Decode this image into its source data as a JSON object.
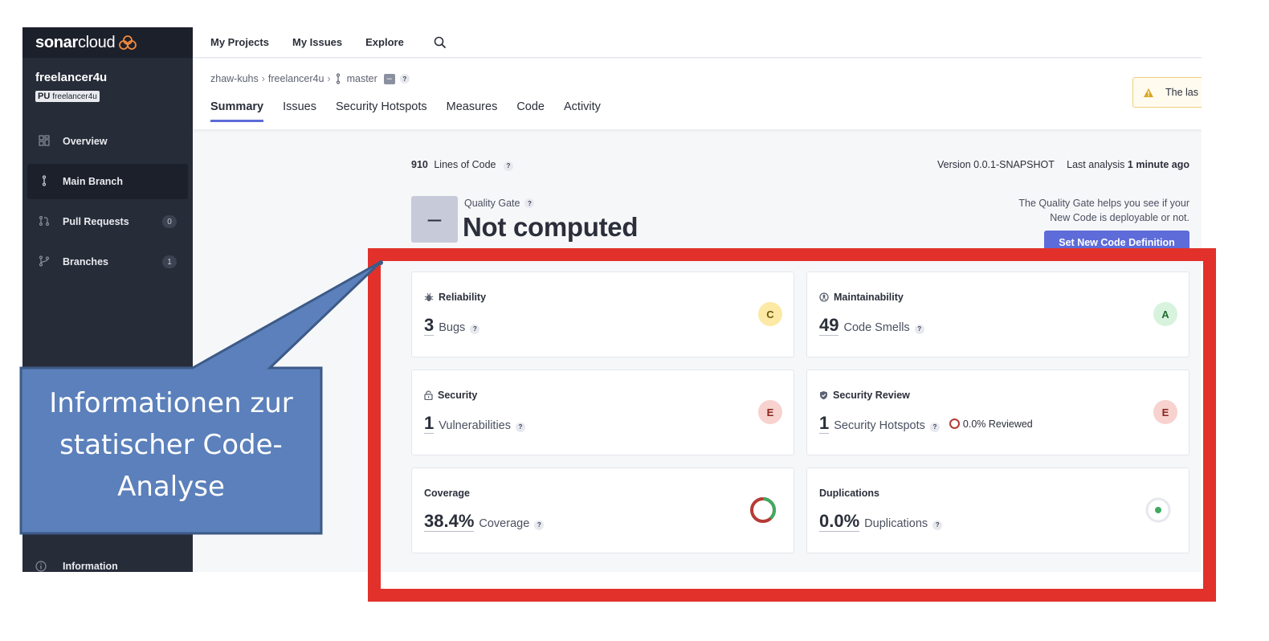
{
  "app": {
    "brand": {
      "bold": "sonar",
      "light": "cloud"
    },
    "topnav": {
      "my_projects": "My Projects",
      "my_issues": "My Issues",
      "explore": "Explore"
    }
  },
  "sidebar": {
    "project_name": "freelancer4u",
    "project_key_badge": "PU",
    "project_key": "freelancer4u",
    "items": [
      {
        "label": "Overview",
        "icon": "grid-icon"
      },
      {
        "label": "Main Branch",
        "icon": "branch-icon",
        "active": true
      },
      {
        "label": "Pull Requests",
        "icon": "pull-request-icon",
        "count": "0"
      },
      {
        "label": "Branches",
        "icon": "branches-icon",
        "count": "1"
      }
    ],
    "information": "Information"
  },
  "breadcrumb": {
    "org": "zhaw-kuhs",
    "project": "freelancer4u",
    "branch": "master",
    "badge": "–",
    "help": "?"
  },
  "tabs": [
    "Summary",
    "Issues",
    "Security Hotspots",
    "Measures",
    "Code",
    "Activity"
  ],
  "warning": {
    "text": "The las"
  },
  "overview": {
    "loc_value": "910",
    "loc_label": "Lines of Code",
    "version": "Version 0.0.1-SNAPSHOT",
    "last_analysis_label": "Last analysis",
    "last_analysis_value": "1 minute ago",
    "quality_gate_label": "Quality Gate",
    "quality_gate_symbol": "–",
    "quality_gate_status": "Not computed",
    "quality_gate_help_line1": "The Quality Gate helps you see if your",
    "quality_gate_help_line2": "New Code is deployable or not.",
    "new_code_button": "Set New Code Definition"
  },
  "measures": {
    "reliability": {
      "title": "Reliability",
      "value": "3",
      "label": "Bugs",
      "rating": "C"
    },
    "maintainability": {
      "title": "Maintainability",
      "value": "49",
      "label": "Code Smells",
      "rating": "A"
    },
    "security": {
      "title": "Security",
      "value": "1",
      "label": "Vulnerabilities",
      "rating": "E"
    },
    "security_review": {
      "title": "Security Review",
      "value": "1",
      "label": "Security Hotspots",
      "reviewed": "0.0% Reviewed",
      "rating": "E"
    },
    "coverage": {
      "title": "Coverage",
      "value": "38.4%",
      "label": "Coverage",
      "fraction": 0.384
    },
    "duplications": {
      "title": "Duplications",
      "value": "0.0%",
      "label": "Duplications",
      "fraction": 0.0
    }
  },
  "callout": {
    "line1": "Informationen zur",
    "line2": "statischer Code-",
    "line3": "Analyse"
  },
  "colors": {
    "sidebar_bg": "#272c39",
    "accent": "#5d6cd8",
    "highlight_red": "#e2312a",
    "callout_fill": "#5b80bb",
    "callout_border": "#3d5a87"
  }
}
